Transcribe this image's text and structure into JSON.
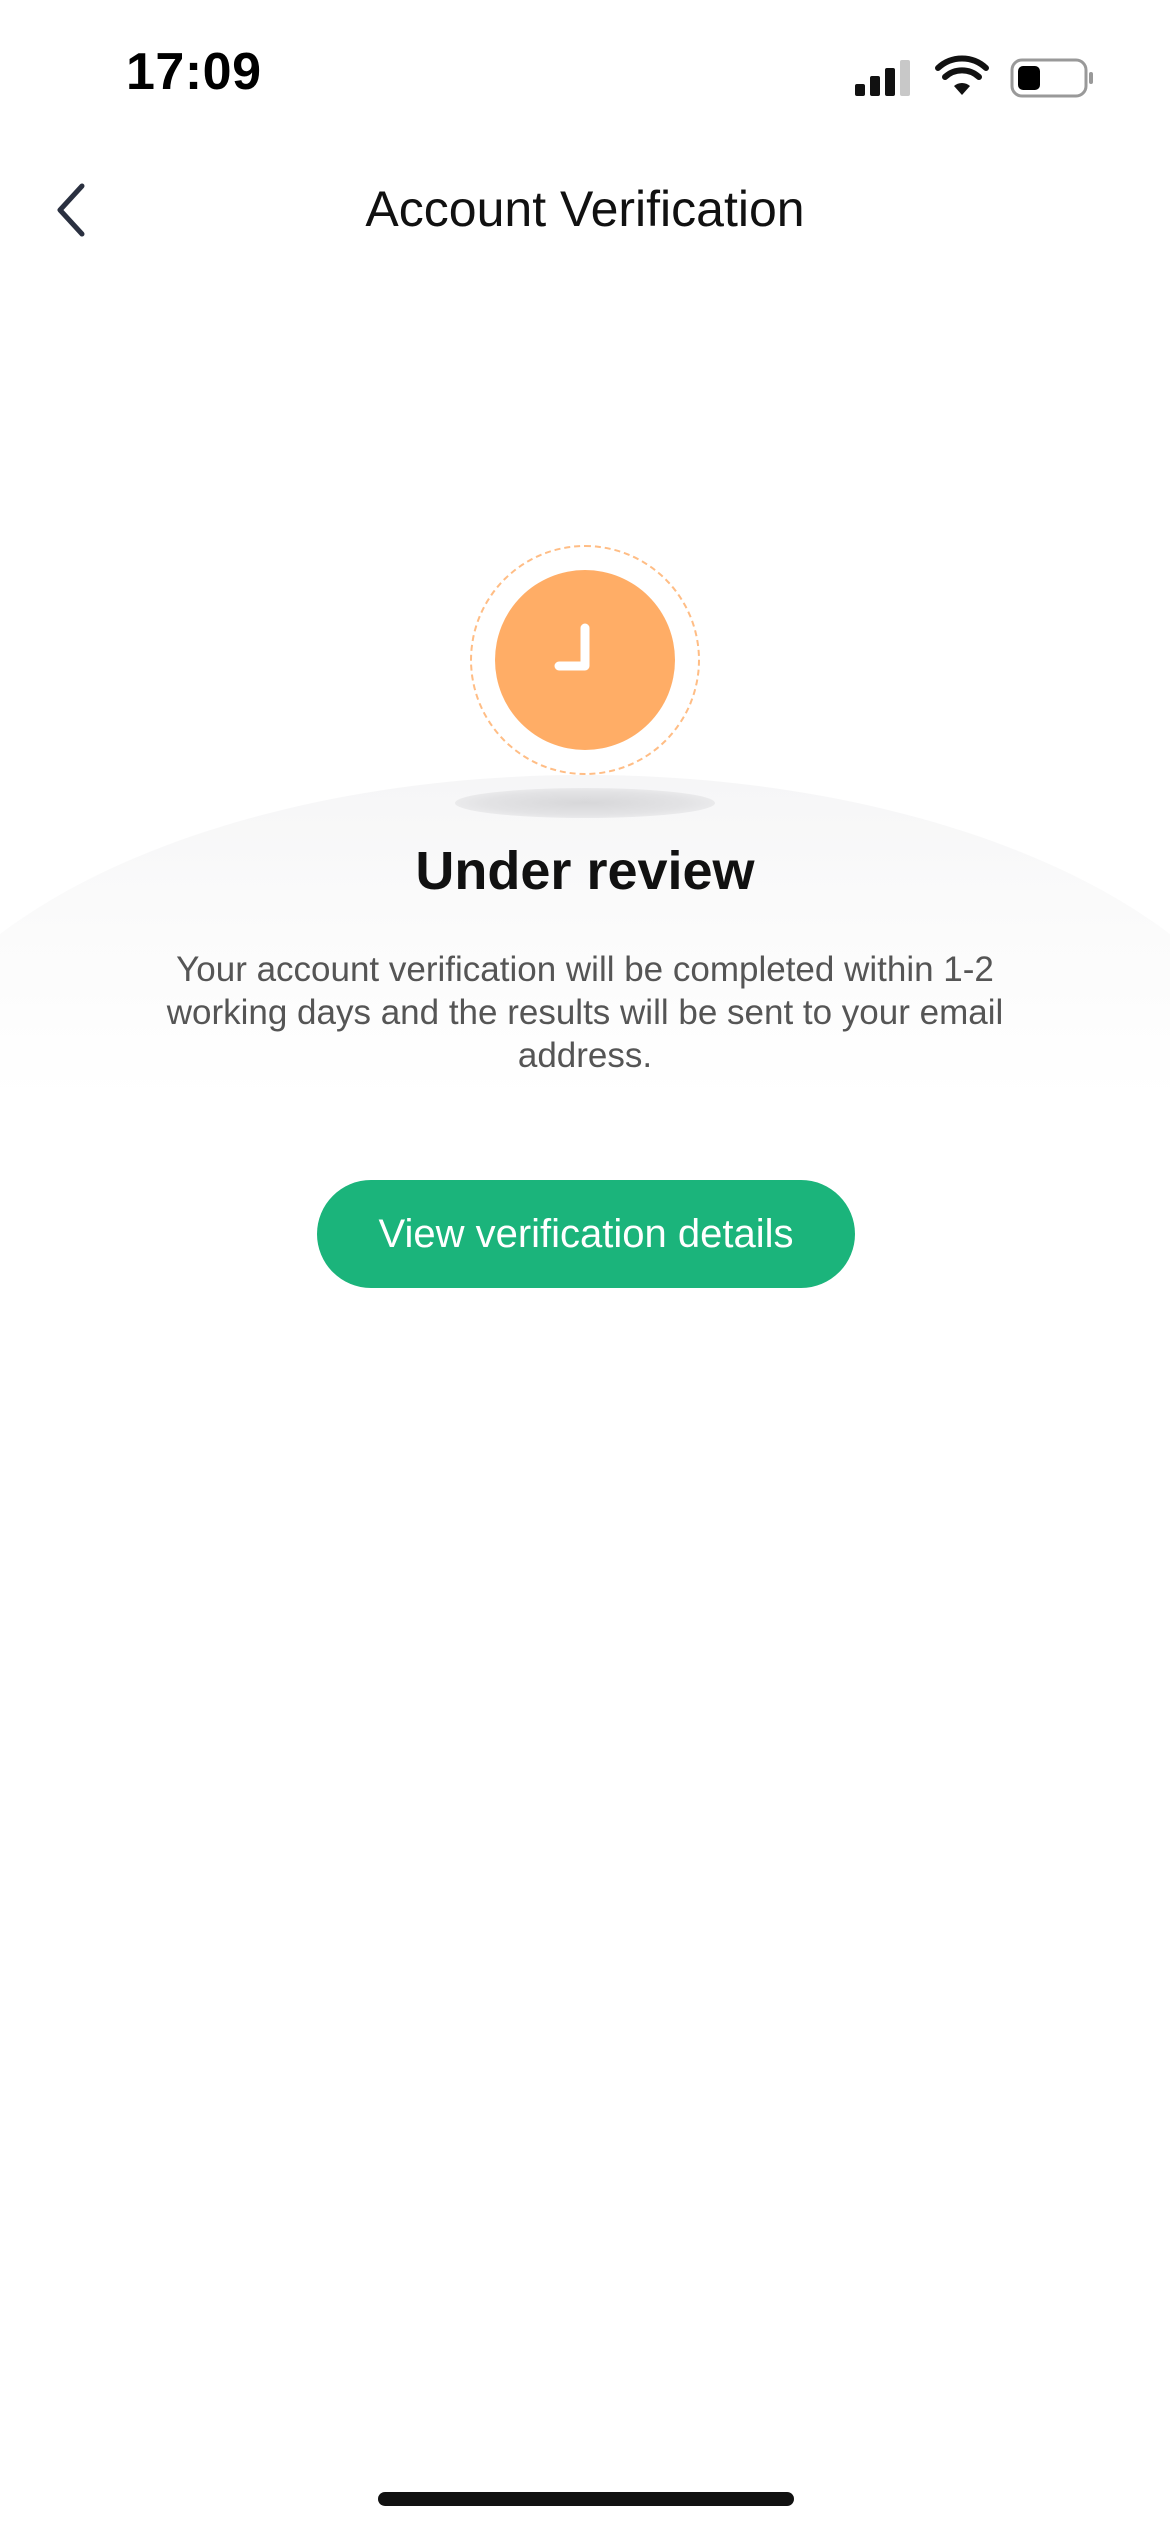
{
  "status_bar": {
    "time": "17:09"
  },
  "nav": {
    "title": "Account Verification",
    "back_icon": "chevron-left-icon"
  },
  "review": {
    "icon": "clock-icon",
    "title": "Under review",
    "description": "Your account verification will be completed within 1-2 working days and the results will be sent to your email address."
  },
  "actions": {
    "details_label": "View verification details"
  },
  "colors": {
    "accent_orange": "#ffad66",
    "primary_green": "#1bb47b"
  }
}
